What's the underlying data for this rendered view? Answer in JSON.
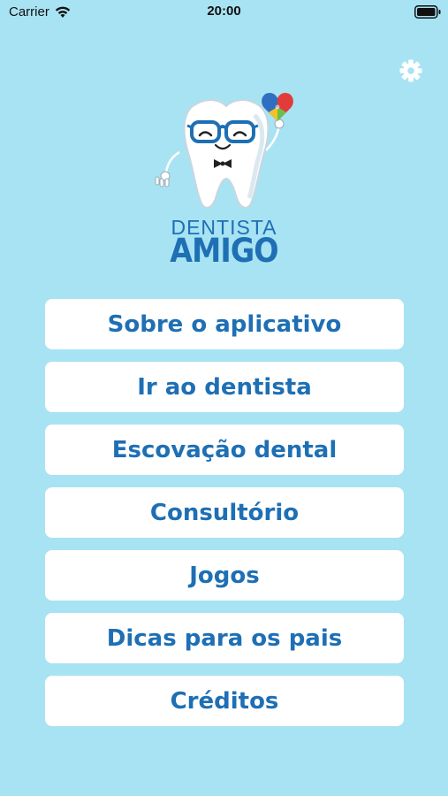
{
  "status_bar": {
    "carrier": "Carrier",
    "time": "20:00",
    "wifi_icon": "wifi-icon",
    "battery_icon": "battery-full-icon"
  },
  "header": {
    "settings_icon": "gear-icon"
  },
  "logo": {
    "line1": "DENTISTA",
    "line2": "AMIGO",
    "mascot_icon": "tooth-mascot-with-glasses-holding-puzzle-heart"
  },
  "menu": {
    "items": [
      {
        "label": "Sobre o aplicativo"
      },
      {
        "label": "Ir ao dentista"
      },
      {
        "label": "Escovação dental"
      },
      {
        "label": "Consultório"
      },
      {
        "label": "Jogos"
      },
      {
        "label": "Dicas para os pais"
      },
      {
        "label": "Créditos"
      }
    ]
  },
  "colors": {
    "background": "#a8e3f3",
    "brand_blue": "#1e6fb4",
    "button_bg": "#ffffff"
  }
}
